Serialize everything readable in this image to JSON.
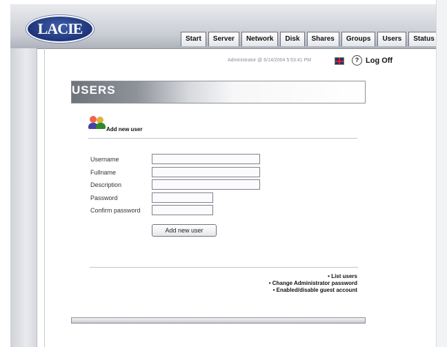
{
  "brand": {
    "logo_text": "LACIE"
  },
  "nav": {
    "tabs": [
      "Start",
      "Server",
      "Network",
      "Disk",
      "Shares",
      "Groups",
      "Users",
      "Status"
    ]
  },
  "status_bar": {
    "text": "Administrator @ 6/14/2004 5:53:41 PM",
    "help_glyph": "?",
    "logoff_label": "Log Off",
    "icons": [
      "uk-flag-icon",
      "help-icon"
    ]
  },
  "page": {
    "section_title": "USERS",
    "subheading": "Add new user",
    "icon": "users-icon"
  },
  "form": {
    "fields": [
      {
        "label": "Username",
        "value": ""
      },
      {
        "label": "Fullname",
        "value": ""
      },
      {
        "label": "Description",
        "value": ""
      },
      {
        "label": "Password",
        "value": ""
      },
      {
        "label": "Confirm password",
        "value": ""
      }
    ],
    "submit_label": "Add new user"
  },
  "links": [
    "• List users",
    "• Change Administrator password",
    "• Enabled/disable guest account"
  ]
}
